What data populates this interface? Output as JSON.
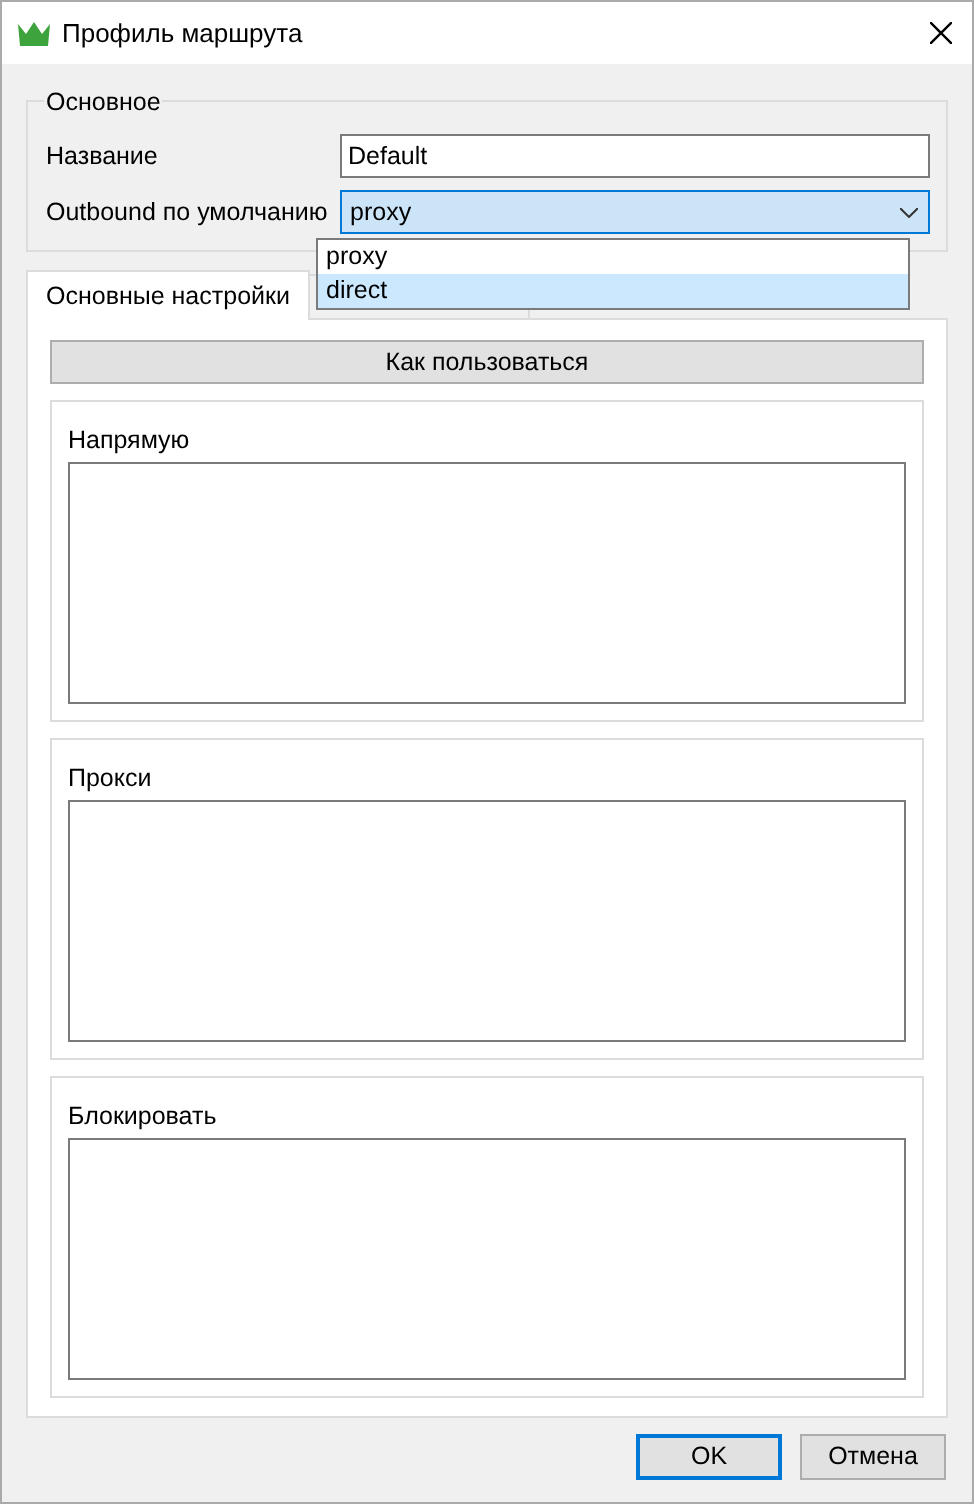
{
  "window": {
    "title": "Профиль маршрута"
  },
  "general": {
    "title": "Основное",
    "name_label": "Название",
    "name_value": "Default",
    "outbound_label": "Outbound по умолчанию",
    "outbound_value": "proxy",
    "dropdown_open": true,
    "options": [
      {
        "label": "proxy",
        "selected": false
      },
      {
        "label": "direct",
        "selected": true
      }
    ]
  },
  "tabs": [
    {
      "label": "Основные настройки",
      "selected": true
    },
    {
      "selected": false
    }
  ],
  "help_button": "Как пользоваться",
  "sections": [
    {
      "title": "Напрямую"
    },
    {
      "title": "Прокси"
    },
    {
      "title": "Блокировать"
    }
  ],
  "buttons": [
    {
      "label": "OK",
      "default": true
    },
    {
      "label": "Отмена",
      "default": false
    }
  ]
}
